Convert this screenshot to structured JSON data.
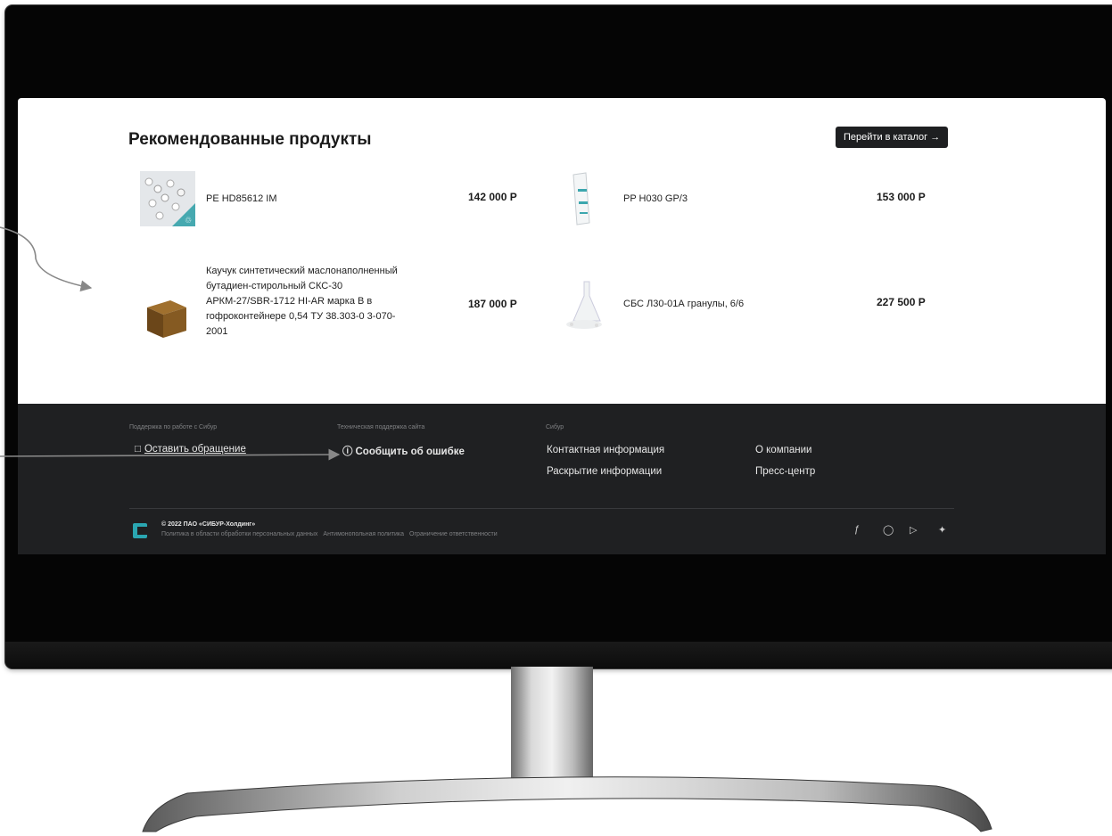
{
  "recommended": {
    "title": "Рекомендованные продукты",
    "catalog_button": "Перейти в каталог →",
    "products": [
      {
        "name": "PE HD85612 IM",
        "price": "142 000 Р"
      },
      {
        "name": "PP H030 GP/3",
        "price": "153 000 Р"
      },
      {
        "name": "Каучук синтетический маслонаполненный бутадиен-стирольный СКС-30 АРКМ-27/SBR-1712 HI-AR марка В в гофроконтейнере 0,54 ТУ 38.303-0 3-070-2001",
        "price": "187 000 Р"
      },
      {
        "name": "СБС Л30-01А гранулы, 6/6",
        "price": "227 500 Р"
      }
    ]
  },
  "footer": {
    "support_label": "Поддержка по работе с Сибур",
    "support_link": "Оставить обращение",
    "tech_label": "Техническая поддержка сайта",
    "tech_link": "Сообщить об ошибке",
    "sibur_label": "Сибур",
    "links": [
      "Контактная информация",
      "Раскрытие информации",
      "О компании",
      "Пресс-центр"
    ],
    "copyright": "© 2022 ПАО «СИБУР-Холдинг»",
    "legal": [
      "Политика в области обработки персональных данных",
      "Антимонопольная политика",
      "Ограничение ответственности"
    ],
    "social_icons": [
      "facebook-icon",
      "instagram-icon",
      "youtube-icon",
      "twitter-icon"
    ]
  },
  "colors": {
    "accent": "#2aa6b1",
    "footer_bg": "#1f2022",
    "button_bg": "#1e1f21"
  }
}
